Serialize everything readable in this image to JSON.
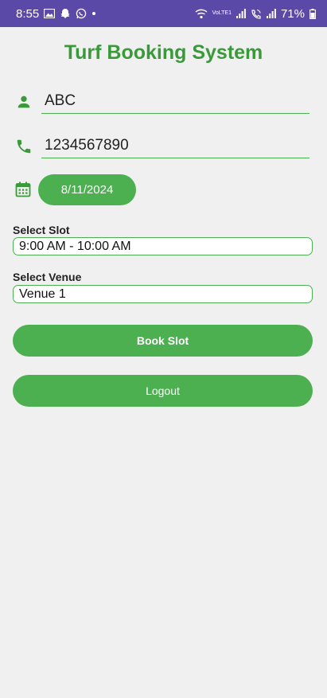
{
  "status_bar": {
    "time": "8:55",
    "network_label": "VoLTE1",
    "battery": "71%",
    "left_icons": [
      "gallery-icon",
      "snapchat-icon",
      "whatsapp-icon",
      "dot-icon"
    ],
    "right_icons": [
      "wifi-icon",
      "signal-icon",
      "wifi-calling-icon",
      "signal-icon",
      "battery-icon"
    ]
  },
  "app": {
    "title": "Turf Booking System"
  },
  "form": {
    "name": {
      "icon": "person-icon",
      "value": "ABC"
    },
    "phone": {
      "icon": "phone-icon",
      "value": "1234567890"
    },
    "date": {
      "icon": "calendar-icon",
      "value": "8/11/2024"
    },
    "slot": {
      "label": "Select Slot",
      "selected": "9:00 AM - 10:00 AM"
    },
    "venue": {
      "label": "Select Venue",
      "selected": "Venue 1"
    }
  },
  "actions": {
    "book_label": "Book Slot",
    "logout_label": "Logout"
  },
  "colors": {
    "status_bar": "#5b49a8",
    "primary": "#4caf50",
    "title": "#3a9a3a",
    "background": "#f0f0f0"
  }
}
